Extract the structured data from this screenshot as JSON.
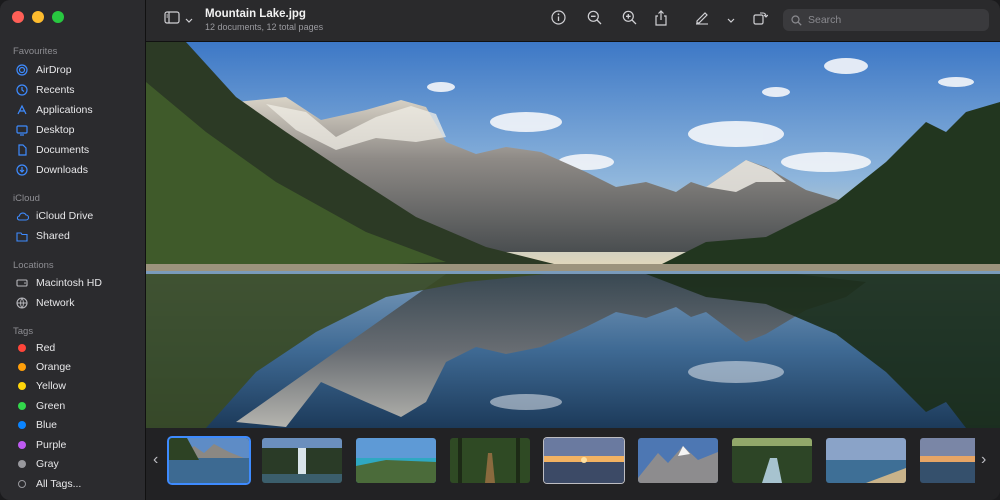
{
  "window": {
    "title": "Mountain Lake.jpg",
    "subtitle": "12 documents, 12 total pages"
  },
  "toolbar": {
    "search_placeholder": "Search",
    "icons": [
      "sidebar-toggle-icon",
      "chevron-down-icon",
      "info-icon",
      "zoom-out-icon",
      "zoom-in-icon",
      "share-icon",
      "markup-pen-icon",
      "chevron-down-icon",
      "rotate-icon",
      "search-icon"
    ]
  },
  "sidebar": {
    "favourites_header": "Favourites",
    "favourites": [
      {
        "label": "AirDrop",
        "icon": "airdrop-icon"
      },
      {
        "label": "Recents",
        "icon": "clock-icon"
      },
      {
        "label": "Applications",
        "icon": "applications-icon"
      },
      {
        "label": "Desktop",
        "icon": "desktop-icon"
      },
      {
        "label": "Documents",
        "icon": "document-icon"
      },
      {
        "label": "Downloads",
        "icon": "download-icon"
      }
    ],
    "icloud_header": "iCloud",
    "icloud": [
      {
        "label": "iCloud Drive",
        "icon": "cloud-icon"
      },
      {
        "label": "Shared",
        "icon": "shared-folder-icon"
      }
    ],
    "locations_header": "Locations",
    "locations": [
      {
        "label": "Macintosh HD",
        "icon": "hard-drive-icon"
      },
      {
        "label": "Network",
        "icon": "network-icon"
      }
    ],
    "tags_header": "Tags",
    "tags": [
      {
        "label": "Red",
        "color": "#ff453a"
      },
      {
        "label": "Orange",
        "color": "#ff9f0a"
      },
      {
        "label": "Yellow",
        "color": "#ffd60a"
      },
      {
        "label": "Green",
        "color": "#32d74b"
      },
      {
        "label": "Blue",
        "color": "#0a84ff"
      },
      {
        "label": "Purple",
        "color": "#bf5af2"
      },
      {
        "label": "Gray",
        "color": "#98989d"
      },
      {
        "label": "All Tags...",
        "color": ""
      }
    ]
  },
  "colors": {
    "accent": "#3e8bff",
    "sidebar_bg": "#2b2b2e",
    "toolbar_bg": "#2a2a2c"
  },
  "thumbnails": [
    {
      "name": "thumb-mountain-lake",
      "selected": true
    },
    {
      "name": "thumb-waterfall",
      "selected": false
    },
    {
      "name": "thumb-coastal-bay",
      "selected": false
    },
    {
      "name": "thumb-forest-path",
      "selected": false
    },
    {
      "name": "thumb-sunset-beach",
      "selected": false
    },
    {
      "name": "thumb-snowy-peaks",
      "selected": false
    },
    {
      "name": "thumb-forest-stream",
      "selected": false
    },
    {
      "name": "thumb-ocean-shore",
      "selected": false
    },
    {
      "name": "thumb-evening-shore",
      "selected": false
    }
  ]
}
